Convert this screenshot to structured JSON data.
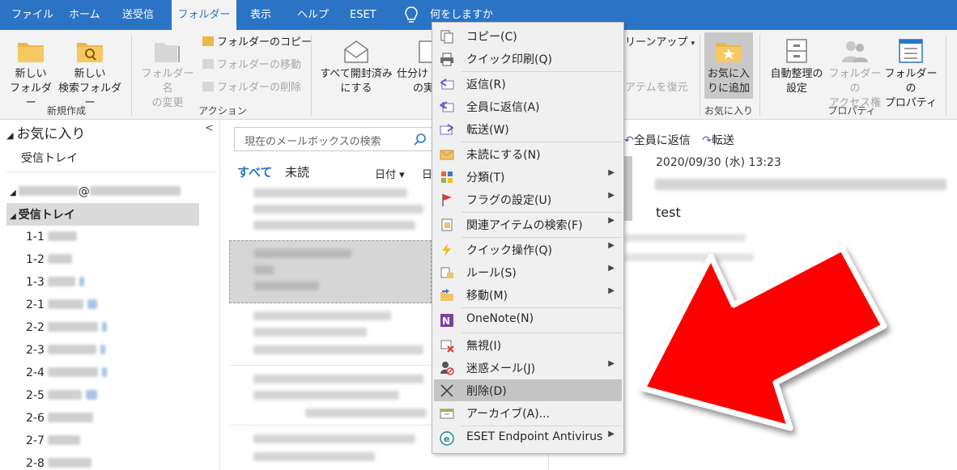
{
  "tabs": [
    {
      "label": "ファイル"
    },
    {
      "label": "ホーム"
    },
    {
      "label": "送受信"
    },
    {
      "label": "フォルダー"
    },
    {
      "label": "表示"
    },
    {
      "label": "ヘルプ"
    },
    {
      "label": "ESET"
    },
    {
      "label": "何をしますか"
    }
  ],
  "ribbon": {
    "new_folder": {
      "line1": "新しい",
      "line2": "フォルダー"
    },
    "new_search_folder": {
      "line1": "新しい",
      "line2": "検索フォルダー"
    },
    "rename_folder": {
      "line1": "フォルダー名",
      "line2": "の変更"
    },
    "copy_folder": "フォルダーのコピー",
    "move_folder": "フォルダーの移動",
    "delete_folder": "フォルダーの削除",
    "mark_all_read": {
      "line1": "すべて開封済み",
      "line2": "にする"
    },
    "sort_partial": {
      "line1": "仕分け",
      "line2": "の実"
    },
    "cleanup": "リーンアップ",
    "restore": "アテムを復元",
    "add_favorite": {
      "line1": "お気に入",
      "line2": "りに追加"
    },
    "auto_archive": {
      "line1": "自動整理の",
      "line2": "設定"
    },
    "folder_permissions": {
      "line1": "フォルダーの",
      "line2": "アクセス権"
    },
    "folder_properties": {
      "line1": "フォルダーの",
      "line2": "プロパティ"
    },
    "groups": {
      "new": "新規作成",
      "actions": "アクション",
      "favorites": "お気に入り",
      "properties": "プロパティ"
    }
  },
  "folder_pane": {
    "favorites": "お気に入り",
    "fav_inbox": "受信トレイ",
    "account_suffix": "@",
    "inbox": "受信トレイ",
    "subfolders": [
      "1-1",
      "1-2",
      "1-3",
      "2-1",
      "2-2",
      "2-3",
      "2-4",
      "2-5",
      "2-6",
      "2-7",
      "2-8"
    ]
  },
  "message_list": {
    "search_placeholder": "現在のメールボックスの検索",
    "filter_all": "すべて",
    "filter_unread": "未読",
    "sort_by": "日付 ▾",
    "sort_partial": "日"
  },
  "reading_pane": {
    "reply_all": "全員に返信",
    "forward": "転送",
    "date": "2020/09/30 (水) 13:23",
    "body": "test"
  },
  "context_menu": {
    "items": [
      {
        "label": "コピー(C)",
        "icon": "copy-icon"
      },
      {
        "label": "クイック印刷(Q)",
        "icon": "print-icon"
      },
      {
        "label": "返信(R)",
        "icon": "reply-icon"
      },
      {
        "label": "全員に返信(A)",
        "icon": "reply-all-icon"
      },
      {
        "label": "転送(W)",
        "icon": "forward-icon"
      },
      {
        "label": "未読にする(N)",
        "icon": "unread-icon"
      },
      {
        "label": "分類(T)",
        "icon": "categorize-icon"
      },
      {
        "label": "フラグの設定(U)",
        "icon": "flag-icon"
      },
      {
        "label": "関連アイテムの検索(F)",
        "icon": "find-related-icon"
      },
      {
        "label": "クイック操作(Q)",
        "icon": "quick-steps-icon"
      },
      {
        "label": "ルール(S)",
        "icon": "rules-icon"
      },
      {
        "label": "移動(M)",
        "icon": "move-icon"
      },
      {
        "label": "OneNote(N)",
        "icon": "onenote-icon"
      },
      {
        "label": "無視(I)",
        "icon": "ignore-icon"
      },
      {
        "label": "迷惑メール(J)",
        "icon": "junk-icon"
      },
      {
        "label": "削除(D)",
        "icon": "delete-icon"
      },
      {
        "label": "アーカイブ(A)...",
        "icon": "archive-icon"
      },
      {
        "label": "ESET Endpoint Antivirus",
        "icon": "eset-icon"
      }
    ],
    "selected": "削除(D)"
  },
  "colors": {
    "tab_bar": "#2b74c5",
    "ribbon": "#f3f3f3",
    "arrow": "#ff0000",
    "selection": "#c4c4c4"
  }
}
